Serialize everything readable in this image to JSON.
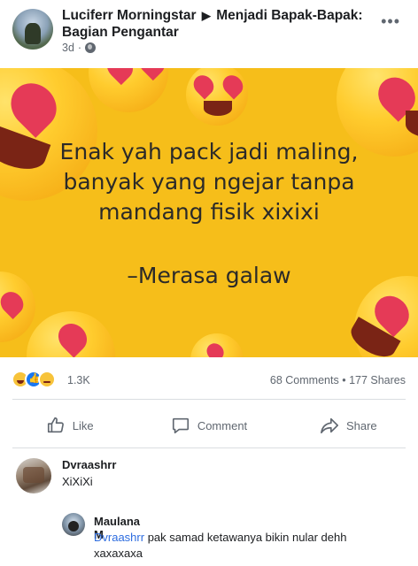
{
  "post": {
    "author": "Luciferr Morningstar",
    "group": "Menjadi Bapak-Bapak: Bagian Pengantar",
    "time": "3d",
    "more_label": "•••",
    "image_text": {
      "quote_line1": "Enak yah pack jadi maling,",
      "quote_line2": "banyak yang ngejar tanpa",
      "quote_line3": "mandang fisik xixixi",
      "signature": "–Merasa galaw"
    }
  },
  "reactions": {
    "icons": [
      "haha-icon",
      "like-icon",
      "sad-icon"
    ],
    "count": "1.3K",
    "comments": "68 Comments",
    "shares": "177 Shares",
    "separator": "•"
  },
  "actions": {
    "like": "Like",
    "comment": "Comment",
    "share": "Share"
  },
  "comments": [
    {
      "name": "Dvraashrr",
      "text": "XiXiXi"
    },
    {
      "name": "Maulana M",
      "mention": "Dvraashrr",
      "text_rest": " pak samad ketawanya bikin nular dehh",
      "text_line2": "xaxaxaxa"
    }
  ],
  "colors": {
    "image_bg": "#f6be1a",
    "link": "#2d6cdf",
    "meta_text": "#606770"
  }
}
